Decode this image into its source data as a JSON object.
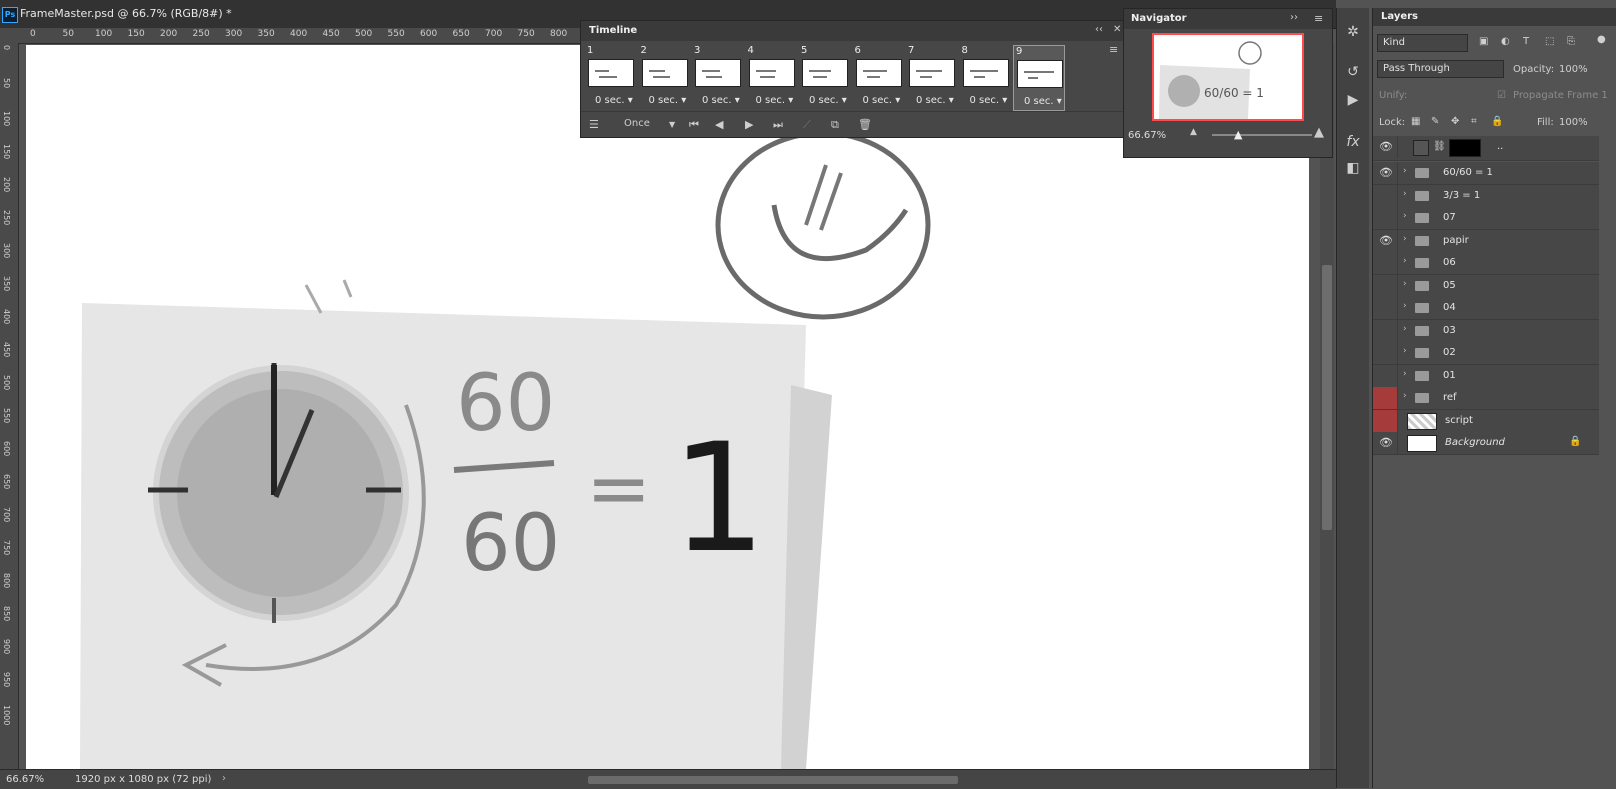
{
  "document": {
    "title": "FrameMaster.psd @ 66.7% (RGB/8#) *",
    "app_badge": "Ps"
  },
  "ruler": {
    "top_labels": [
      "0",
      "50",
      "100",
      "150",
      "200",
      "250",
      "300",
      "350",
      "400",
      "450",
      "500",
      "550",
      "600",
      "650",
      "700",
      "750",
      "800"
    ],
    "left_labels": [
      "0",
      "50",
      "100",
      "150",
      "200",
      "250",
      "300",
      "350",
      "400",
      "450",
      "500",
      "550",
      "600",
      "650",
      "700",
      "750",
      "800",
      "850",
      "900",
      "950",
      "1000"
    ]
  },
  "status": {
    "zoom": "66.67%",
    "info": "1920 px x 1080 px (72 ppi)",
    "arrow": "›"
  },
  "timeline": {
    "title": "Timeline",
    "frames": [
      {
        "num": "1",
        "delay": "0 sec."
      },
      {
        "num": "2",
        "delay": "0 sec."
      },
      {
        "num": "3",
        "delay": "0 sec."
      },
      {
        "num": "4",
        "delay": "0 sec."
      },
      {
        "num": "5",
        "delay": "0 sec."
      },
      {
        "num": "6",
        "delay": "0 sec."
      },
      {
        "num": "7",
        "delay": "0 sec."
      },
      {
        "num": "8",
        "delay": "0 sec."
      },
      {
        "num": "9",
        "delay": "0 sec."
      }
    ],
    "loop": "Once"
  },
  "navigator": {
    "title": "Navigator",
    "zoom": "66.67%",
    "preview_text": "60/60 = 1"
  },
  "layers": {
    "title": "Layers",
    "filter_kind": "Kind",
    "blend_mode": "Pass Through",
    "opacity_label": "Opacity:",
    "opacity_value": "100%",
    "unify_label": "Unify:",
    "propagate_label": "Propagate Frame 1",
    "lock_label": "Lock:",
    "fill_label": "Fill:",
    "fill_value": "100%",
    "top_row_name": "..",
    "items": [
      {
        "name": "60/60 = 1",
        "visible": true
      },
      {
        "name": "3/3 = 1",
        "visible": false
      },
      {
        "name": "07",
        "visible": false
      },
      {
        "name": "papir",
        "visible": true
      },
      {
        "name": "06",
        "visible": false
      },
      {
        "name": "05",
        "visible": false
      },
      {
        "name": "04",
        "visible": false
      },
      {
        "name": "03",
        "visible": false
      },
      {
        "name": "02",
        "visible": false
      },
      {
        "name": "01",
        "visible": false
      },
      {
        "name": "ref",
        "visible": false
      },
      {
        "name": "script",
        "visible": false
      },
      {
        "name": "Background",
        "visible": true
      }
    ]
  },
  "canvas": {
    "fraction_top": "60",
    "fraction_bottom": "60",
    "equals": "=",
    "result": "1"
  },
  "colors": {
    "accent_red": "#a63b3b",
    "navigator_frame": "#ff4b4b",
    "ps_blue": "#31a8ff"
  }
}
